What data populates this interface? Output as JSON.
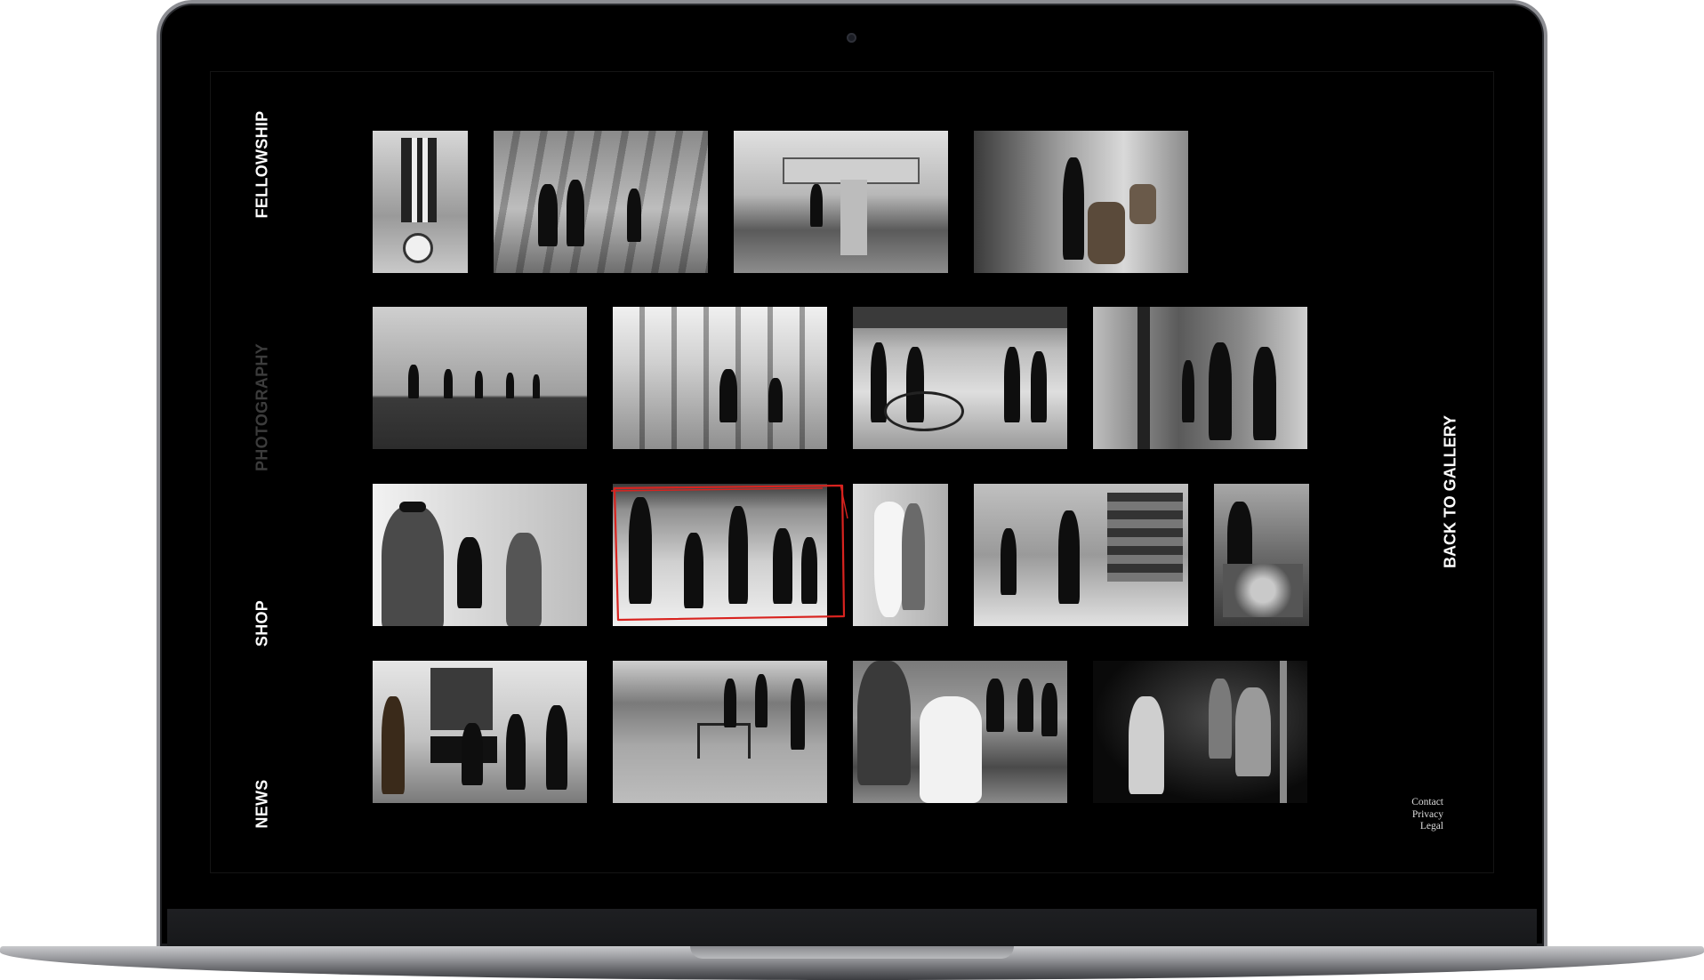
{
  "nav": {
    "fellowship": "FELLOWSHIP",
    "photography": "PHOTOGRAPHY",
    "shop": "SHOP",
    "news": "NEWS"
  },
  "back_to_gallery": "BACK TO GALLERY",
  "footer": {
    "contact": "Contact",
    "privacy": "Privacy",
    "legal": "Legal"
  },
  "colors": {
    "background": "#000000",
    "nav_text": "#ffffff",
    "nav_active": "#3c3c3c",
    "selection": "#d8231f"
  },
  "gallery": {
    "rows": 4,
    "selected_photo": "row-3-photo-2",
    "photos": [
      "row-1-photo-1",
      "row-1-photo-2",
      "row-1-photo-3",
      "row-1-photo-4",
      "row-2-photo-1",
      "row-2-photo-2",
      "row-2-photo-3",
      "row-2-photo-4",
      "row-3-photo-1",
      "row-3-photo-2",
      "row-3-photo-3",
      "row-3-photo-4",
      "row-3-photo-5",
      "row-4-photo-1",
      "row-4-photo-2",
      "row-4-photo-3",
      "row-4-photo-4"
    ]
  }
}
